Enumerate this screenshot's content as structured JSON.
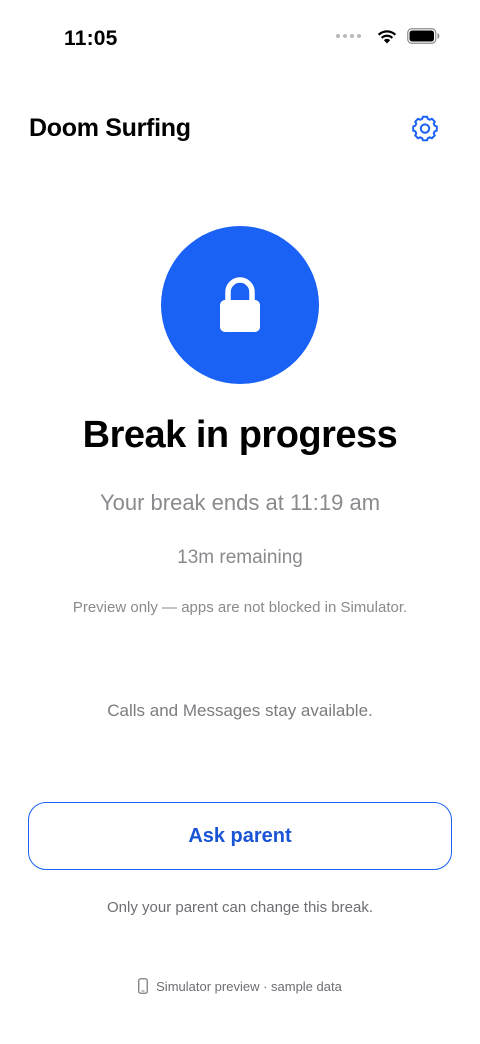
{
  "status_bar": {
    "time": "11:05",
    "icons": [
      "signal-dots-icon",
      "wifi-icon",
      "battery-icon"
    ]
  },
  "header": {
    "title": "Doom Surfing",
    "settings_icon": "gear-icon"
  },
  "hero": {
    "icon": "lock-icon",
    "accent_color": "#1a62f5"
  },
  "break": {
    "headline": "Break in progress",
    "ends_at": "Your break ends at 11:19 am",
    "remaining": "13m remaining",
    "preview_note": "Preview only — apps are not blocked in Simulator.",
    "calls_note": "Calls and Messages stay available."
  },
  "actions": {
    "ask_parent_label": "Ask parent",
    "parent_note": "Only your parent can change this break."
  },
  "footer": {
    "icon": "phone-icon",
    "text": "Simulator preview · sample data"
  }
}
